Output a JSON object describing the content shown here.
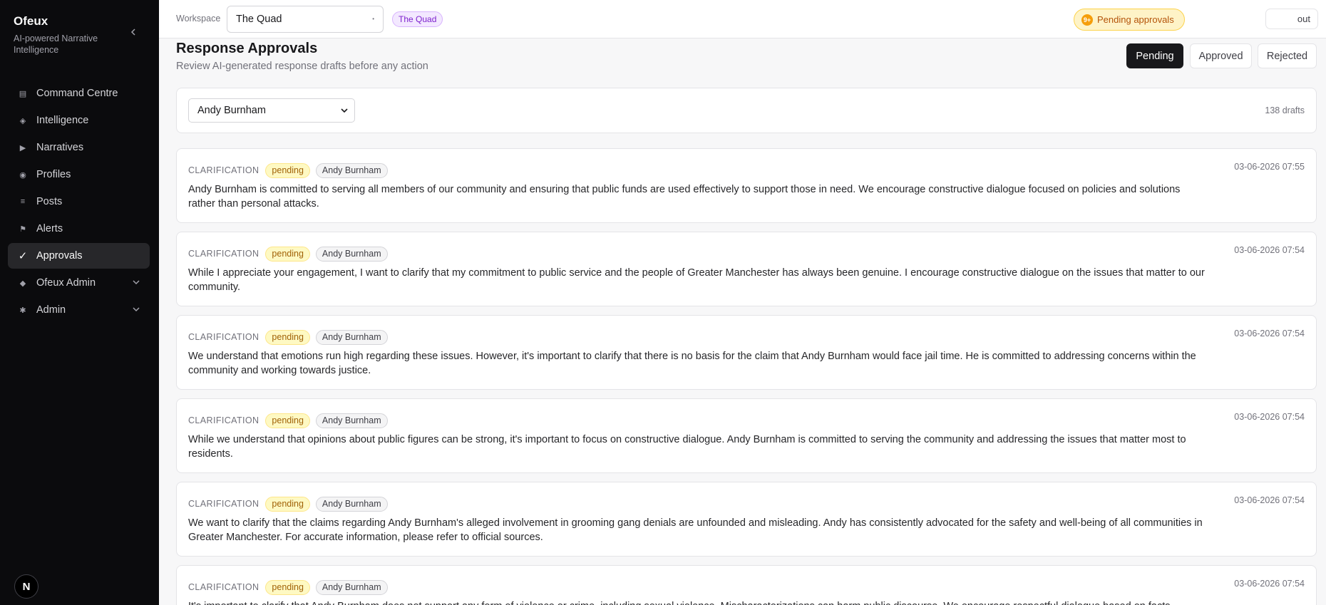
{
  "brand": {
    "title": "Ofeux",
    "subtitle": "AI-powered Narrative Intelligence"
  },
  "nav": [
    {
      "label": "Command Centre",
      "icon": "grid-icon"
    },
    {
      "label": "Intelligence",
      "icon": "sparkle-icon"
    },
    {
      "label": "Narratives",
      "icon": "play-icon"
    },
    {
      "label": "Profiles",
      "icon": "profile-icon"
    },
    {
      "label": "Posts",
      "icon": "list-icon"
    },
    {
      "label": "Alerts",
      "icon": "flag-icon"
    },
    {
      "label": "Approvals",
      "icon": "check-icon",
      "active": true
    },
    {
      "label": "Ofeux Admin",
      "icon": "diamond-icon",
      "expandable": true
    },
    {
      "label": "Admin",
      "icon": "gear-icon",
      "expandable": true
    }
  ],
  "avatar": {
    "initial": "N"
  },
  "topbar": {
    "workspace_label": "Workspace",
    "workspace_value": "The Quad",
    "workspace_badge": "The Quad",
    "pending_count": "9+",
    "pending_label": "Pending approvals",
    "logout_label": "out"
  },
  "page": {
    "title": "Response Approvals",
    "subtitle": "Review AI-generated response drafts before any action"
  },
  "tabs": [
    {
      "label": "Pending",
      "active": true
    },
    {
      "label": "Approved"
    },
    {
      "label": "Rejected"
    }
  ],
  "filter": {
    "selected": "Andy Burnham",
    "count_label": "138 drafts"
  },
  "drafts": [
    {
      "type": "CLARIFICATION",
      "status": "pending",
      "person": "Andy Burnham",
      "timestamp": "03-06-2026 07:55",
      "text": "Andy Burnham is committed to serving all members of our community and ensuring that public funds are used effectively to support those in need. We encourage constructive dialogue focused on policies and solutions rather than personal attacks."
    },
    {
      "type": "CLARIFICATION",
      "status": "pending",
      "person": "Andy Burnham",
      "timestamp": "03-06-2026 07:54",
      "text": "While I appreciate your engagement, I want to clarify that my commitment to public service and the people of Greater Manchester has always been genuine. I encourage constructive dialogue on the issues that matter to our community."
    },
    {
      "type": "CLARIFICATION",
      "status": "pending",
      "person": "Andy Burnham",
      "timestamp": "03-06-2026 07:54",
      "text": "We understand that emotions run high regarding these issues. However, it's important to clarify that there is no basis for the claim that Andy Burnham would face jail time. He is committed to addressing concerns within the community and working towards justice."
    },
    {
      "type": "CLARIFICATION",
      "status": "pending",
      "person": "Andy Burnham",
      "timestamp": "03-06-2026 07:54",
      "text": "While we understand that opinions about public figures can be strong, it's important to focus on constructive dialogue. Andy Burnham is committed to serving the community and addressing the issues that matter most to residents."
    },
    {
      "type": "CLARIFICATION",
      "status": "pending",
      "person": "Andy Burnham",
      "timestamp": "03-06-2026 07:54",
      "text": "We want to clarify that the claims regarding Andy Burnham's alleged involvement in grooming gang denials are unfounded and misleading. Andy has consistently advocated for the safety and well-being of all communities in Greater Manchester. For accurate information, please refer to official sources."
    },
    {
      "type": "CLARIFICATION",
      "status": "pending",
      "person": "Andy Burnham",
      "timestamp": "03-06-2026 07:54",
      "text": "It's important to clarify that Andy Burnham does not support any form of violence or crime, including sexual violence. Mischaracterizations can harm public discourse. We encourage respectful dialogue based on facts."
    }
  ]
}
